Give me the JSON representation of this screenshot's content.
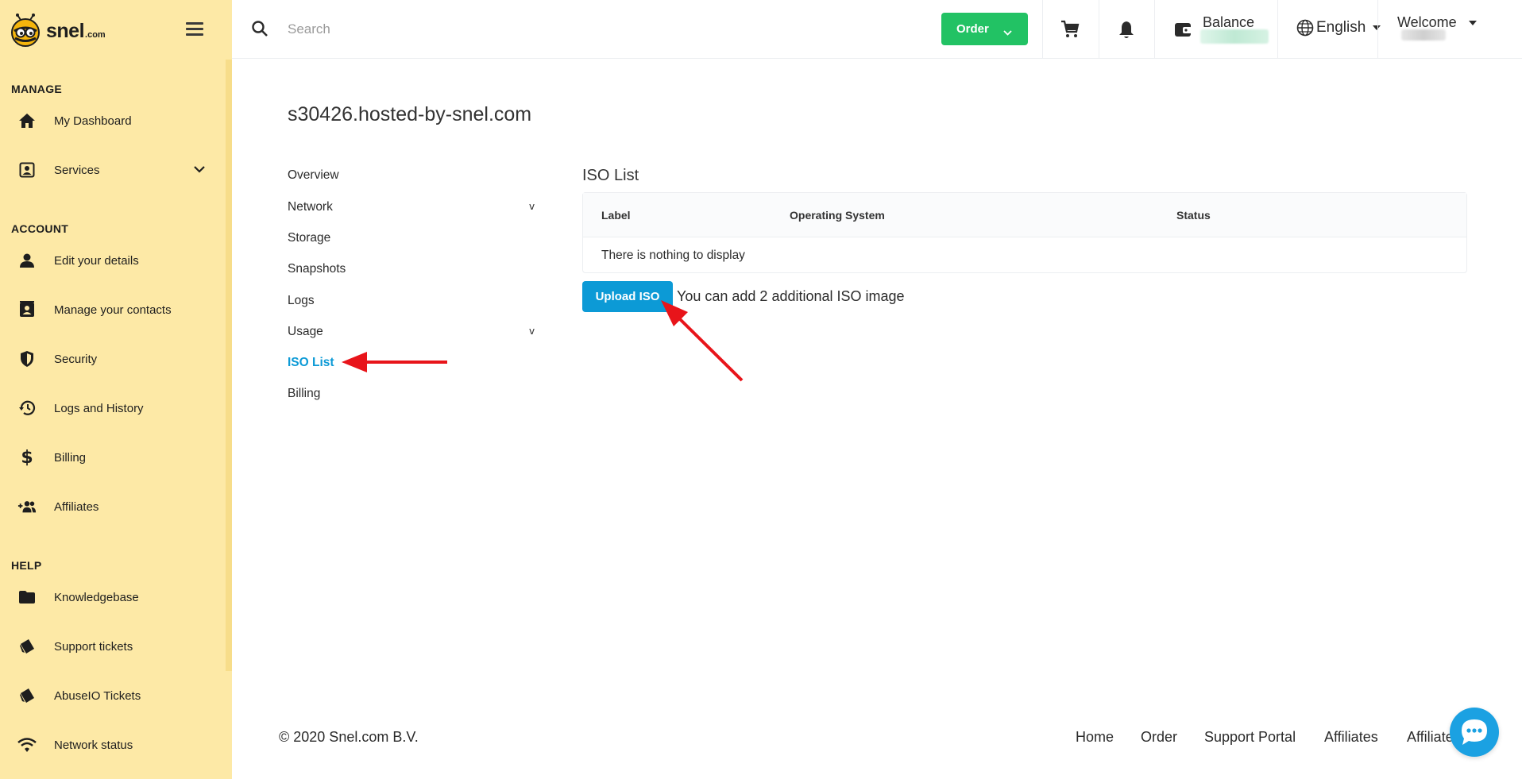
{
  "brand": {
    "name": "snel",
    "suffix": ".com"
  },
  "search": {
    "placeholder": "Search"
  },
  "topbar": {
    "order_label": "Order",
    "balance_label": "Balance",
    "language": "English",
    "welcome": "Welcome"
  },
  "sidebar": {
    "sections": {
      "manage": "MANAGE",
      "account": "ACCOUNT",
      "help": "HELP"
    },
    "items": [
      {
        "label": "My Dashboard",
        "icon": "home-icon"
      },
      {
        "label": "Services",
        "icon": "contact-card-icon"
      },
      {
        "label": "Edit your details",
        "icon": "person-icon"
      },
      {
        "label": "Manage your contacts",
        "icon": "contacts-book-icon"
      },
      {
        "label": "Security",
        "icon": "shield-icon"
      },
      {
        "label": "Logs and History",
        "icon": "history-icon"
      },
      {
        "label": "Billing",
        "icon": "dollar-icon"
      },
      {
        "label": "Affiliates",
        "icon": "add-people-icon"
      },
      {
        "label": "Knowledgebase",
        "icon": "folder-icon"
      },
      {
        "label": "Support tickets",
        "icon": "ticket-icon"
      },
      {
        "label": "AbuseIO Tickets",
        "icon": "ticket-icon"
      },
      {
        "label": "Network status",
        "icon": "wifi-icon"
      }
    ]
  },
  "main": {
    "title": "s30426.hosted-by-snel.com",
    "subnav": [
      {
        "label": "Overview"
      },
      {
        "label": "Network",
        "chevron": "v"
      },
      {
        "label": "Storage"
      },
      {
        "label": "Snapshots"
      },
      {
        "label": "Logs"
      },
      {
        "label": "Usage",
        "chevron": "v"
      },
      {
        "label": "ISO List",
        "active": true
      },
      {
        "label": "Billing"
      }
    ],
    "iso": {
      "heading": "ISO List",
      "columns": [
        "Label",
        "Operating System",
        "Status"
      ],
      "empty_text": "There is nothing to display",
      "upload_label": "Upload ISO",
      "note": "You can add 2 additional ISO image"
    }
  },
  "footer": {
    "copyright": "© 2020 Snel.com B.V.",
    "links": [
      "Home",
      "Order",
      "Support Portal",
      "Affiliates",
      "Affiliates"
    ]
  },
  "colors": {
    "sidebar_bg": "#fde9a6",
    "accent_blue": "#0c9ad6",
    "order_green": "#22c264",
    "annotation_red": "#e8141a"
  }
}
